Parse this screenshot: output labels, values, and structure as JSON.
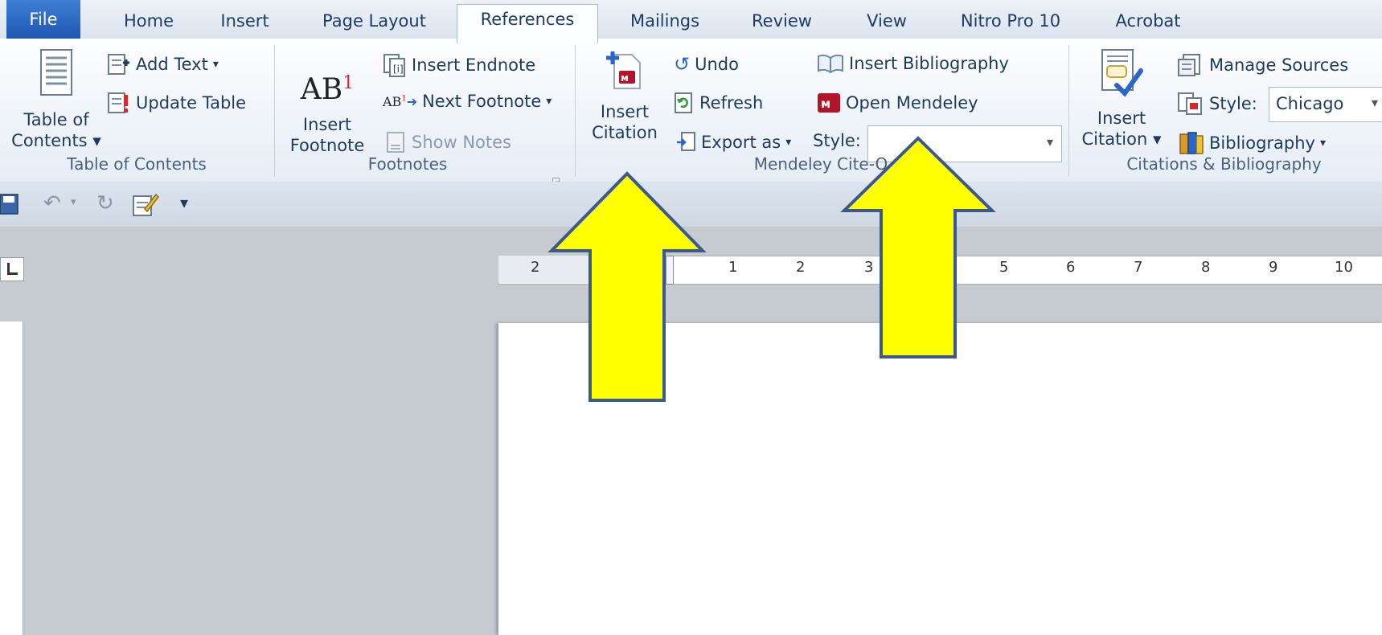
{
  "tabs": {
    "file": "File",
    "home": "Home",
    "insert": "Insert",
    "page_layout": "Page Layout",
    "references": "References",
    "mailings": "Mailings",
    "review": "Review",
    "view": "View",
    "nitro": "Nitro Pro 10",
    "acrobat": "Acrobat"
  },
  "toc": {
    "label_line1": "Table of",
    "label_line2": "Contents",
    "add_text": "Add Text",
    "update_table": "Update Table",
    "group": "Table of Contents"
  },
  "footnotes": {
    "insert_line1": "Insert",
    "insert_line2": "Footnote",
    "insert_endnote": "Insert Endnote",
    "next_footnote": "Next Footnote",
    "show_notes": "Show Notes",
    "group": "Footnotes"
  },
  "mendeley": {
    "insert_line1": "Insert",
    "insert_line2": "Citation",
    "undo": "Undo",
    "refresh": "Refresh",
    "export_as": "Export as",
    "style_label": "Style:",
    "style_value": "",
    "insert_bibliography": "Insert Bibliography",
    "open_mendeley": "Open Mendeley",
    "group": "Mendeley Cite-O"
  },
  "citations": {
    "insert_line1": "Insert",
    "insert_line2": "Citation",
    "manage_sources": "Manage Sources",
    "style_label": "Style:",
    "style_value": "Chicago",
    "bibliography": "Bibliography",
    "group": "Citations & Bibliography"
  },
  "ruler": {
    "left_marks": [
      "2"
    ],
    "marks": [
      "1",
      "2",
      "3",
      "5",
      "6",
      "7",
      "8",
      "9",
      "10"
    ]
  },
  "colors": {
    "accent": "#1d56b3",
    "arrow_fill": "#ffff00",
    "arrow_stroke": "#3d5a86",
    "mendeley_red": "#b0152a"
  }
}
